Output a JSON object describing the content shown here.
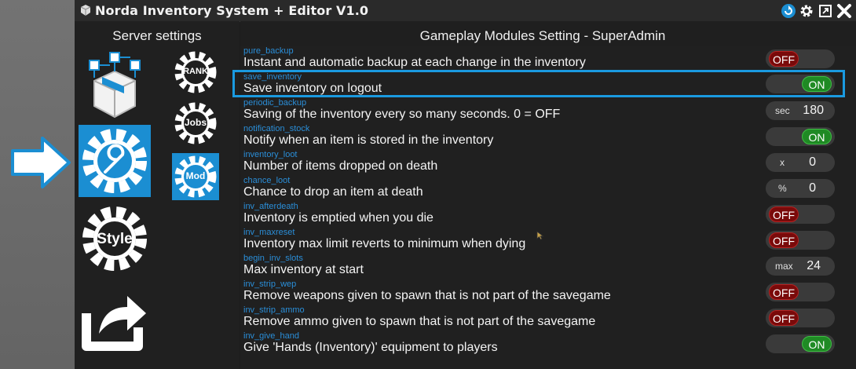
{
  "window": {
    "title": "Norda Inventory System + Editor V1.0",
    "icons": [
      "app-logo-icon",
      "refresh-icon",
      "gear-icon",
      "maximize-icon",
      "close-icon"
    ]
  },
  "sidebar": {
    "title": "Server settings",
    "items": [
      {
        "name": "inventory-box",
        "icon": "box-network-icon"
      },
      {
        "name": "server-settings",
        "icon": "wrench-gear-icon",
        "active": true
      },
      {
        "name": "style",
        "label": "Style"
      },
      {
        "name": "export",
        "icon": "share-arrow-icon"
      }
    ],
    "submenu": [
      {
        "label": "RANK"
      },
      {
        "label": "Jobs"
      },
      {
        "label": "Mod",
        "active": true
      }
    ]
  },
  "main": {
    "title": "Gameplay Modules Setting - SuperAdmin",
    "settings": [
      {
        "key": "pure_backup",
        "label": "Instant and automatic backup at each change in the inventory",
        "type": "toggle",
        "value": "OFF"
      },
      {
        "key": "save_inventory",
        "label": "Save inventory on logout",
        "type": "toggle",
        "value": "ON",
        "highlighted": true
      },
      {
        "key": "periodic_backup",
        "label": "Saving of the inventory every so many seconds. 0 = OFF",
        "type": "number",
        "unit": "sec",
        "value": "180"
      },
      {
        "key": "notification_stock",
        "label": "Notify when an item is stored in the inventory",
        "type": "toggle",
        "value": "ON"
      },
      {
        "key": "inventory_loot",
        "label": "Number of items dropped on death",
        "type": "number",
        "unit": "x",
        "value": "0"
      },
      {
        "key": "chance_loot",
        "label": "Chance to drop an item at death",
        "type": "number",
        "unit": "%",
        "value": "0"
      },
      {
        "key": "inv_afterdeath",
        "label": "Inventory is emptied when you die",
        "type": "toggle",
        "value": "OFF"
      },
      {
        "key": "inv_maxreset",
        "label": "Inventory max limit reverts to minimum when dying",
        "type": "toggle",
        "value": "OFF"
      },
      {
        "key": "begin_inv_slots",
        "label": "Max inventory at start",
        "type": "number",
        "unit": "max",
        "value": "24"
      },
      {
        "key": "inv_strip_wep",
        "label": "Remove weapons given to spawn that is not part of the savegame",
        "type": "toggle",
        "value": "OFF"
      },
      {
        "key": "inv_strip_ammo",
        "label": "Remove ammo given to spawn that is not part of the savegame",
        "type": "toggle",
        "value": "OFF"
      },
      {
        "key": "inv_give_hand",
        "label": "Give 'Hands (Inventory)' equipment to players",
        "type": "toggle",
        "value": "ON"
      }
    ]
  },
  "colors": {
    "accent": "#1b8ed2",
    "on": "#1f8a24",
    "off": "#7a0a0a"
  }
}
